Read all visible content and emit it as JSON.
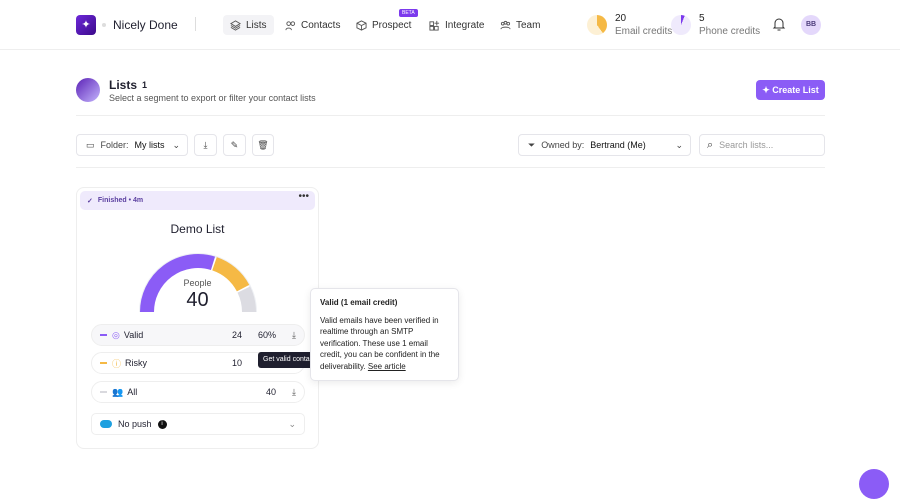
{
  "header": {
    "brand": "Nicely Done",
    "nav": [
      {
        "label": "Lists"
      },
      {
        "label": "Contacts"
      },
      {
        "label": "Prospect",
        "badge": "BETA"
      },
      {
        "label": "Integrate"
      },
      {
        "label": "Team"
      }
    ],
    "credits": [
      {
        "value": "20",
        "label": "Email credits"
      },
      {
        "value": "5",
        "label": "Phone credits"
      }
    ],
    "avatar": "BB"
  },
  "page": {
    "title": "Lists",
    "count": "1",
    "subtitle": "Select a segment to export or filter your contact lists",
    "create_label": "Create List"
  },
  "toolbar": {
    "folder_label": "Folder:",
    "folder_value": "My lists",
    "owner_label": "Owned by:",
    "owner_value": "Bertrand (Me)",
    "search_placeholder": "Search lists..."
  },
  "card": {
    "status": "Finished • 4m",
    "title": "Demo List",
    "people_label": "People",
    "people_count": "40",
    "rows": [
      {
        "label": "Valid",
        "count": "24",
        "pct": "60%",
        "color": "#8b5cf6"
      },
      {
        "label": "Risky",
        "count": "10",
        "color": "#f5b945"
      },
      {
        "label": "All",
        "count": "40",
        "color": "#d9d9de"
      }
    ],
    "gauge": {
      "valid_fraction": 0.6,
      "risky_fraction": 0.25
    },
    "push_label": "No push"
  },
  "tooltip": "Get valid contacts",
  "popover": {
    "title": "Valid (1 email credit)",
    "body": "Valid emails have been verified in realtime through an SMTP verification. These use 1 email credit, you can be confident in the deliverability.",
    "link": "See article"
  },
  "colors": {
    "accent": "#8b5cf6",
    "risky": "#f5b945"
  }
}
